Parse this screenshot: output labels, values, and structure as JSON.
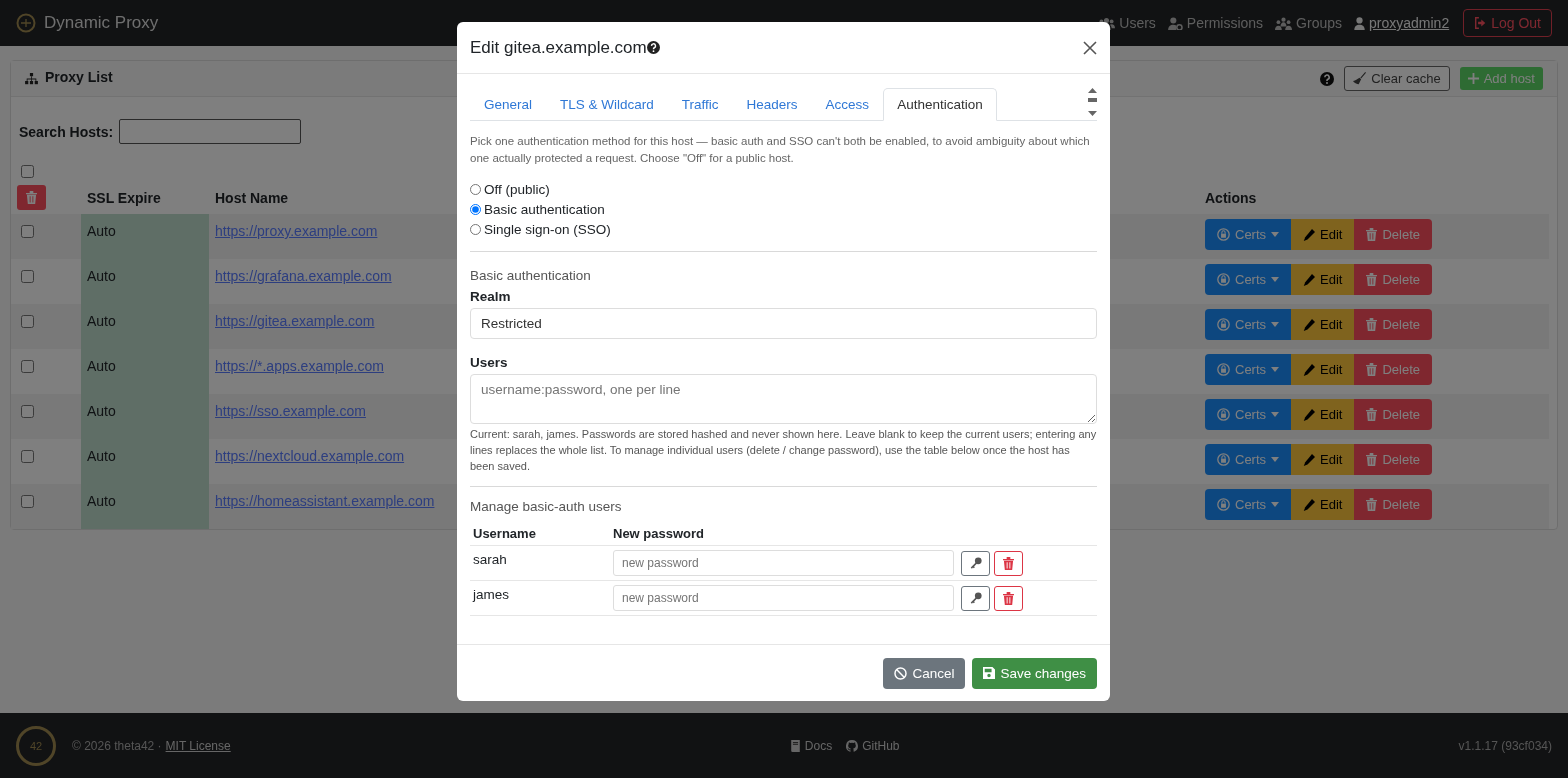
{
  "navbar": {
    "brand": "Dynamic Proxy",
    "items": [
      {
        "label": "Users"
      },
      {
        "label": "Permissions"
      },
      {
        "label": "Groups"
      }
    ],
    "user": "proxyadmin2",
    "logout": "Log Out"
  },
  "card": {
    "title": "Proxy List",
    "clear_cache": "Clear cache",
    "add_host": "Add host",
    "search_label": "Search Hosts:"
  },
  "table": {
    "select_all_checked": false,
    "columns": [
      "SSL Expire",
      "Host Name",
      "Actions"
    ],
    "rows": [
      {
        "checked": false,
        "ssl_expire": "Auto",
        "host": "https://proxy.example.com",
        "actions": [
          "Certs",
          "Edit",
          "Delete"
        ]
      },
      {
        "checked": false,
        "ssl_expire": "Auto",
        "host": "https://grafana.example.com",
        "actions": [
          "Certs",
          "Edit",
          "Delete"
        ]
      },
      {
        "checked": false,
        "ssl_expire": "Auto",
        "host": "https://gitea.example.com",
        "actions": [
          "Certs",
          "Edit",
          "Delete"
        ]
      },
      {
        "checked": false,
        "ssl_expire": "Auto",
        "host": "https://*.apps.example.com",
        "actions": [
          "Certs",
          "Edit",
          "Delete"
        ]
      },
      {
        "checked": false,
        "ssl_expire": "Auto",
        "host": "https://sso.example.com",
        "actions": [
          "Certs",
          "Edit",
          "Delete"
        ]
      },
      {
        "checked": false,
        "ssl_expire": "Auto",
        "host": "https://nextcloud.example.com",
        "actions": [
          "Certs",
          "Edit",
          "Delete"
        ]
      },
      {
        "checked": false,
        "ssl_expire": "Auto",
        "host": "https://homeassistant.example.com",
        "actions": [
          "Certs",
          "Edit",
          "Delete"
        ]
      }
    ]
  },
  "modal": {
    "title": "Edit gitea.example.com",
    "tabs": [
      {
        "label": "General",
        "selected": false
      },
      {
        "label": "TLS & Wildcard",
        "selected": false
      },
      {
        "label": "Traffic",
        "selected": false
      },
      {
        "label": "Headers",
        "selected": false
      },
      {
        "label": "Access",
        "selected": false
      },
      {
        "label": "Authentication",
        "selected": true
      }
    ],
    "intro": "Pick one authentication method for this host — basic auth and SSO can't both be enabled, to avoid ambiguity about which one actually protected a request. Choose \"Off\" for a public host.",
    "auth_methods": [
      {
        "label": "Off (public)",
        "selected": false
      },
      {
        "label": "Basic authentication",
        "selected": true
      },
      {
        "label": "Single sign-on (SSO)",
        "selected": false
      }
    ],
    "section_title": "Basic authentication",
    "realm": {
      "label": "Realm",
      "value": "Restricted"
    },
    "users": {
      "label": "Users",
      "placeholder": "username:password, one per line",
      "help": "Current: sarah, james. Passwords are stored hashed and never shown here. Leave blank to keep the current users; entering any lines replaces the whole list. To manage individual users (delete / change password), use the table below once the host has been saved."
    },
    "manage": {
      "title": "Manage basic-auth users",
      "columns": [
        "Username",
        "New password"
      ],
      "rows": [
        {
          "username": "sarah",
          "placeholder": "new password"
        },
        {
          "username": "james",
          "placeholder": "new password"
        }
      ]
    },
    "cancel": "Cancel",
    "save": "Save changes"
  },
  "footer": {
    "logo_text": "42",
    "copyright": "© 2026 theta42 ·",
    "license": "MIT License",
    "links": [
      "Docs",
      "GitHub"
    ],
    "version": "v1.1.17 (93cf034)"
  }
}
